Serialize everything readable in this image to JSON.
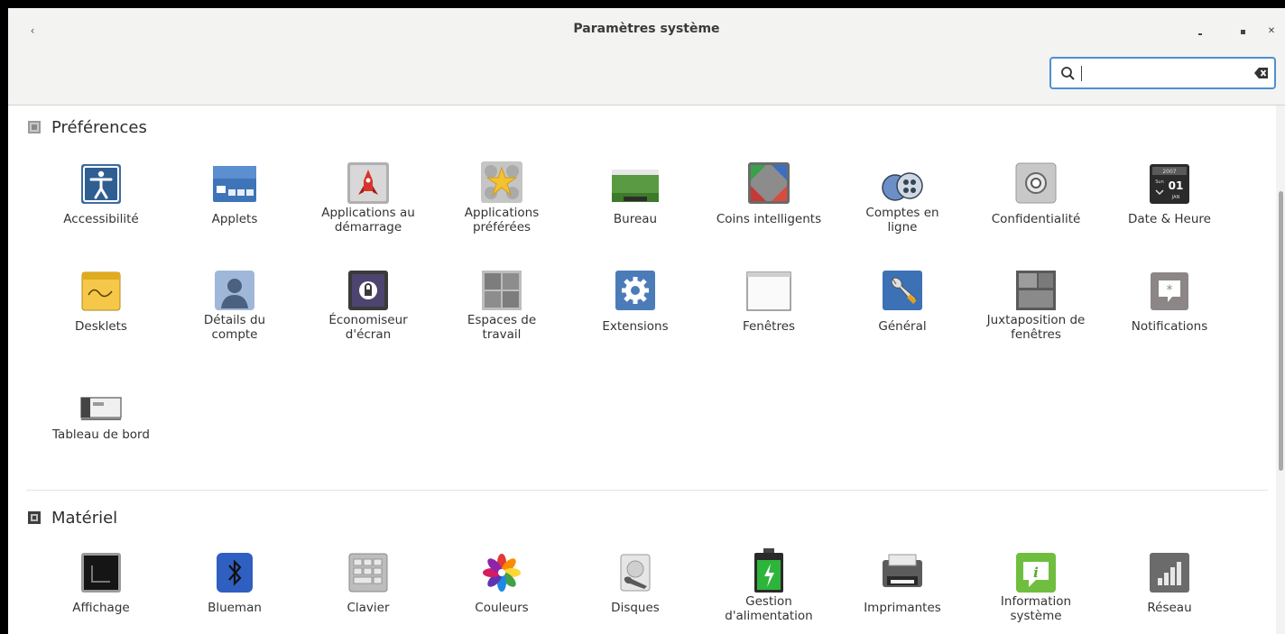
{
  "window": {
    "title": "Paramètres système"
  },
  "search": {
    "value": "",
    "placeholder": ""
  },
  "sections": [
    {
      "title": "Préférences",
      "items": [
        {
          "label": "Accessibilité",
          "icon": "accessibility-icon"
        },
        {
          "label": "Applets",
          "icon": "applets-icon"
        },
        {
          "label": "Applications au\ndémarrage",
          "icon": "startup-applications-icon"
        },
        {
          "label": "Applications\npréférées",
          "icon": "preferred-applications-icon"
        },
        {
          "label": "Bureau",
          "icon": "desktop-icon"
        },
        {
          "label": "Coins intelligents",
          "icon": "hot-corners-icon"
        },
        {
          "label": "Comptes en\nligne",
          "icon": "online-accounts-icon"
        },
        {
          "label": "Confidentialité",
          "icon": "privacy-icon"
        },
        {
          "label": "Date & Heure",
          "icon": "calendar-icon"
        },
        {
          "label": "Desklets",
          "icon": "desklets-note-icon"
        },
        {
          "label": "Détails du\ncompte",
          "icon": "user-account-icon"
        },
        {
          "label": "Économiseur\nd'écran",
          "icon": "screensaver-lock-icon"
        },
        {
          "label": "Espaces de\ntravail",
          "icon": "workspaces-icon"
        },
        {
          "label": "Extensions",
          "icon": "extensions-gear-icon"
        },
        {
          "label": "Fenêtres",
          "icon": "windows-icon"
        },
        {
          "label": "Général",
          "icon": "general-wrench-icon"
        },
        {
          "label": "Juxtaposition de\nfenêtres",
          "icon": "window-tiling-icon"
        },
        {
          "label": "Notifications",
          "icon": "notifications-icon"
        },
        {
          "label": "Tableau de bord",
          "icon": "panel-icon"
        }
      ]
    },
    {
      "title": "Matériel",
      "items": [
        {
          "label": "Affichage",
          "icon": "display-icon"
        },
        {
          "label": "Blueman",
          "icon": "bluetooth-icon"
        },
        {
          "label": "Clavier",
          "icon": "keyboard-icon"
        },
        {
          "label": "Couleurs",
          "icon": "colors-icon"
        },
        {
          "label": "Disques",
          "icon": "disks-icon"
        },
        {
          "label": "Gestion\nd'alimentation",
          "icon": "power-battery-icon"
        },
        {
          "label": "Imprimantes",
          "icon": "printer-icon"
        },
        {
          "label": "Information\nsystème",
          "icon": "system-info-icon"
        },
        {
          "label": "Réseau",
          "icon": "network-bars-icon"
        }
      ]
    }
  ],
  "calendar_icon": {
    "year": "2007",
    "day_name": "Sun",
    "day": "01",
    "month": "JAN"
  },
  "colors": {
    "accent": "#4f8fd1",
    "header_bg": "#f3f3f2"
  }
}
